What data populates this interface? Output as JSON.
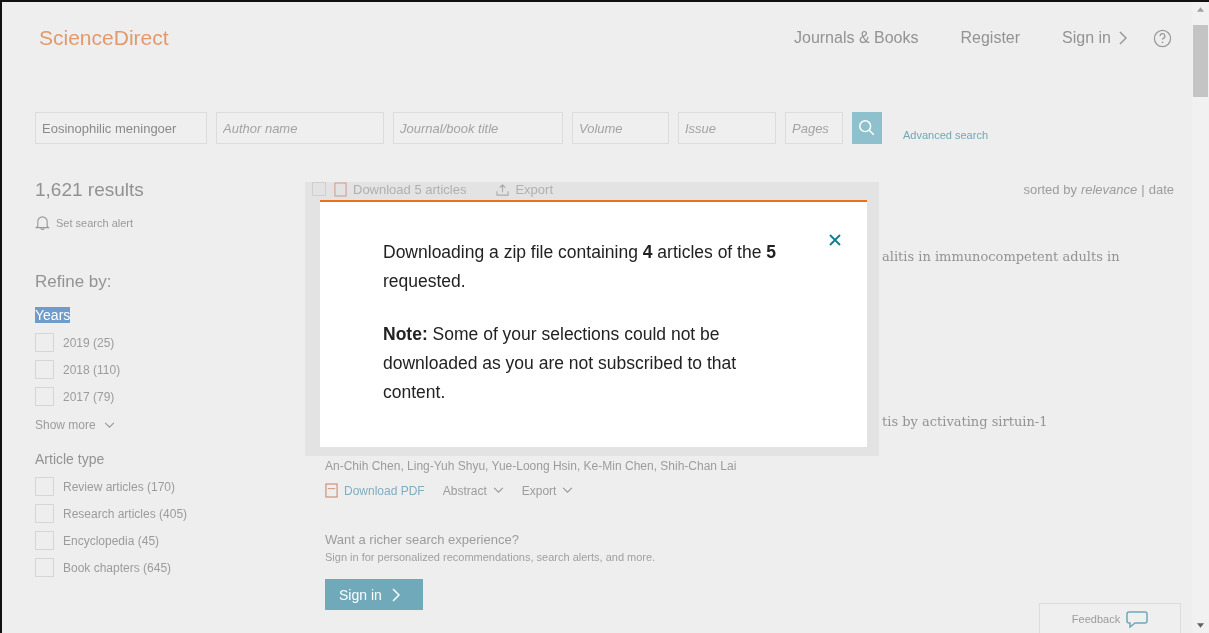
{
  "header": {
    "logo": "ScienceDirect",
    "nav": [
      {
        "label": "Journals & Books",
        "chevron": false
      },
      {
        "label": "Register",
        "chevron": false
      },
      {
        "label": "Sign in",
        "chevron": true
      }
    ]
  },
  "search": {
    "fields": [
      {
        "value": "Eosinophilic meningoer"
      },
      {
        "placeholder": "Author name"
      },
      {
        "placeholder": "Journal/book title"
      },
      {
        "placeholder": "Volume"
      },
      {
        "placeholder": "Issue"
      },
      {
        "placeholder": "Pages"
      }
    ],
    "advanced_link": "Advanced search"
  },
  "sidebar": {
    "results_count": "1,621 results",
    "alert_link": "Set search alert",
    "refine_title": "Refine by:",
    "groups": [
      {
        "title": "Years",
        "highlighted": true,
        "options": [
          {
            "label": "2019 (25)",
            "checked": false
          },
          {
            "label": "2018 (110)",
            "checked": false
          },
          {
            "label": "2017 (79)",
            "checked": false
          }
        ],
        "show_more": "Show more"
      },
      {
        "title": "Article type",
        "highlighted": false,
        "options": [
          {
            "label": "Review articles (170)",
            "checked": false
          },
          {
            "label": "Research articles (405)",
            "checked": false
          },
          {
            "label": "Encyclopedia (45)",
            "checked": false
          },
          {
            "label": "Book chapters (645)",
            "checked": false
          }
        ]
      }
    ]
  },
  "toolbar": {
    "select_all_checked": false,
    "download": "Download 5 articles",
    "export": "Export",
    "sort_prefix": "sorted by",
    "separator": "|",
    "sort_options": [
      {
        "label": "relevance",
        "selected": true
      },
      {
        "label": "date",
        "selected": false
      }
    ]
  },
  "results": [
    {
      "title_fragment": "alitis in immunocompetent adults in"
    },
    {
      "title_fragment": "tis by activating sirtuin-1",
      "authors": "An-Chih Chen, Ling-Yuh Shyu, Yue-Loong Hsin, Ke-Min Chen, Shih-Chan Lai",
      "actions": [
        {
          "label": "Download PDF",
          "kind": "pdf"
        },
        {
          "label": "Abstract",
          "kind": "dropdown"
        },
        {
          "label": "Export",
          "kind": "dropdown"
        }
      ]
    }
  ],
  "promo": {
    "title": "Want a richer search experience?",
    "text": "Sign in for personalized recommendations, search alerts, and more.",
    "button": "Sign in"
  },
  "feedback": "Feedback",
  "modal": {
    "paragraphs": [
      "Downloading a zip file containing **4** articles of the **5** requested.",
      "**Note:** Some of your selections could not be downloaded as you are not subscribed to that content."
    ]
  }
}
